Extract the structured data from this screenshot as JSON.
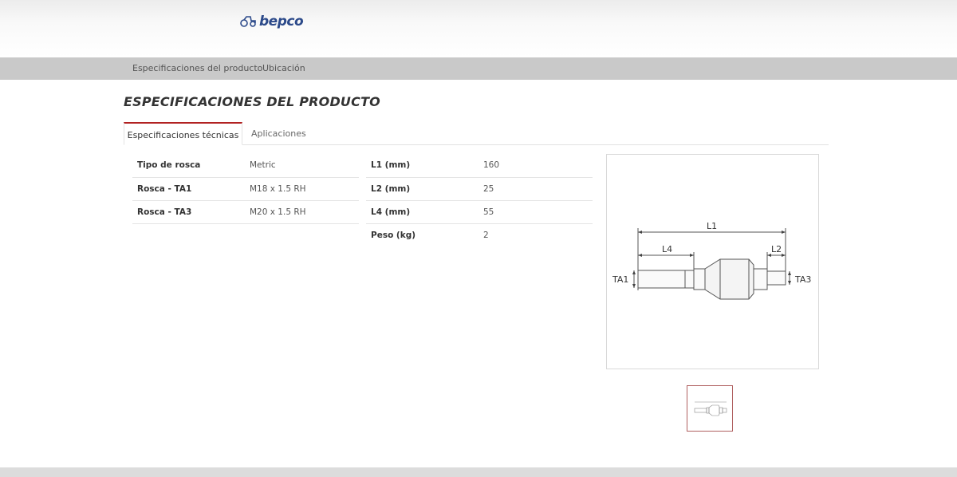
{
  "brand": {
    "logo_text": "bepco",
    "color": "#2c4a8a"
  },
  "nav": {
    "items": [
      "Especificaciones del producto",
      "Ubicación"
    ]
  },
  "section": {
    "title": "ESPECIFICACIONES DEL PRODUCTO"
  },
  "tabs": {
    "active": "Especificaciones técnicas",
    "inactive": "Aplicaciones",
    "accent": "#b22222"
  },
  "specs_left": [
    {
      "key": "Tipo de rosca",
      "value": "Metric"
    },
    {
      "key": "Rosca - TA1",
      "value": "M18 x 1.5 RH"
    },
    {
      "key": "Rosca - TA3",
      "value": "M20 x 1.5 RH"
    }
  ],
  "specs_right": [
    {
      "key": "L1 (mm)",
      "value": "160"
    },
    {
      "key": "L2 (mm)",
      "value": "25"
    },
    {
      "key": "L4 (mm)",
      "value": "55"
    },
    {
      "key": "Peso (kg)",
      "value": "2"
    }
  ],
  "diagram": {
    "labels": {
      "l1": "L1",
      "l2": "L2",
      "l4": "L4",
      "ta1": "TA1",
      "ta3": "TA3"
    }
  }
}
